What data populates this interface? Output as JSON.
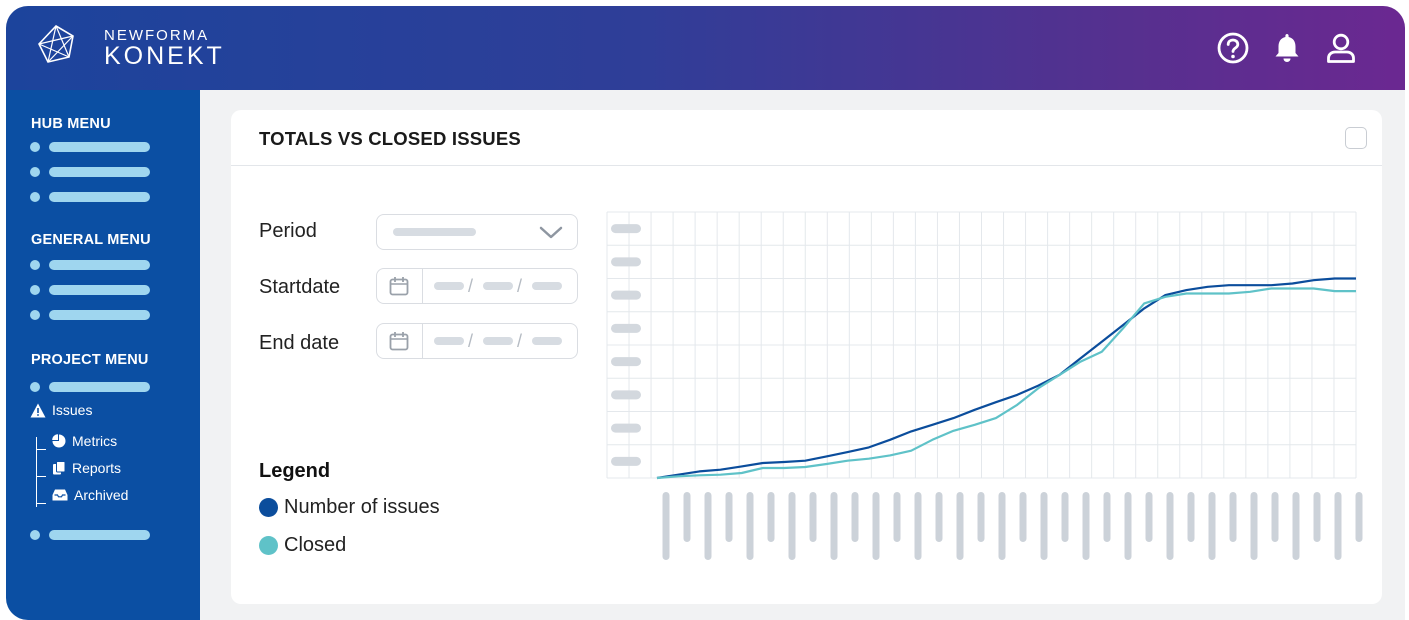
{
  "brand": {
    "line1": "NEWFORMA",
    "line2": "KONEKT"
  },
  "header_icons": [
    "help-icon",
    "bell-icon",
    "user-icon"
  ],
  "sidebar": {
    "hub_menu": "HUB MENU",
    "general_menu": "GENERAL MENU",
    "project_menu": "PROJECT MENU",
    "issues": "Issues",
    "metrics": "Metrics",
    "reports": "Reports",
    "archived": "Archived"
  },
  "card": {
    "title": "TOTALS VS CLOSED ISSUES",
    "period_label": "Period",
    "startdate_label": "Startdate",
    "enddate_label": "End date"
  },
  "legend": {
    "title": "Legend",
    "items": [
      {
        "label": "Number of issues",
        "color": "#0b4d9c"
      },
      {
        "label": "Closed",
        "color": "#5fc2c8"
      }
    ]
  },
  "colors": {
    "accent": "#0b4fa3",
    "series_total": "#0b4d9c",
    "series_closed": "#5fc2c8"
  },
  "chart_data": {
    "type": "line",
    "grid": true,
    "legend_placement": "left",
    "x_count": 34,
    "y_range": [
      0,
      8
    ],
    "series": [
      {
        "name": "Number of issues",
        "values": [
          0,
          0.1,
          0.2,
          0.25,
          0.35,
          0.45,
          0.48,
          0.52,
          0.65,
          0.78,
          0.92,
          1.15,
          1.4,
          1.6,
          1.8,
          2.05,
          2.28,
          2.5,
          2.78,
          3.1,
          3.6,
          4.1,
          4.6,
          5.1,
          5.5,
          5.65,
          5.75,
          5.8,
          5.8,
          5.8,
          5.85,
          5.95,
          6.0,
          6.0
        ]
      },
      {
        "name": "Closed",
        "values": [
          0,
          0.05,
          0.08,
          0.1,
          0.15,
          0.3,
          0.3,
          0.33,
          0.42,
          0.52,
          0.58,
          0.68,
          0.82,
          1.15,
          1.42,
          1.6,
          1.8,
          2.2,
          2.7,
          3.1,
          3.5,
          3.8,
          4.5,
          5.25,
          5.45,
          5.55,
          5.55,
          5.55,
          5.6,
          5.7,
          5.7,
          5.7,
          5.62,
          5.62
        ]
      }
    ]
  }
}
